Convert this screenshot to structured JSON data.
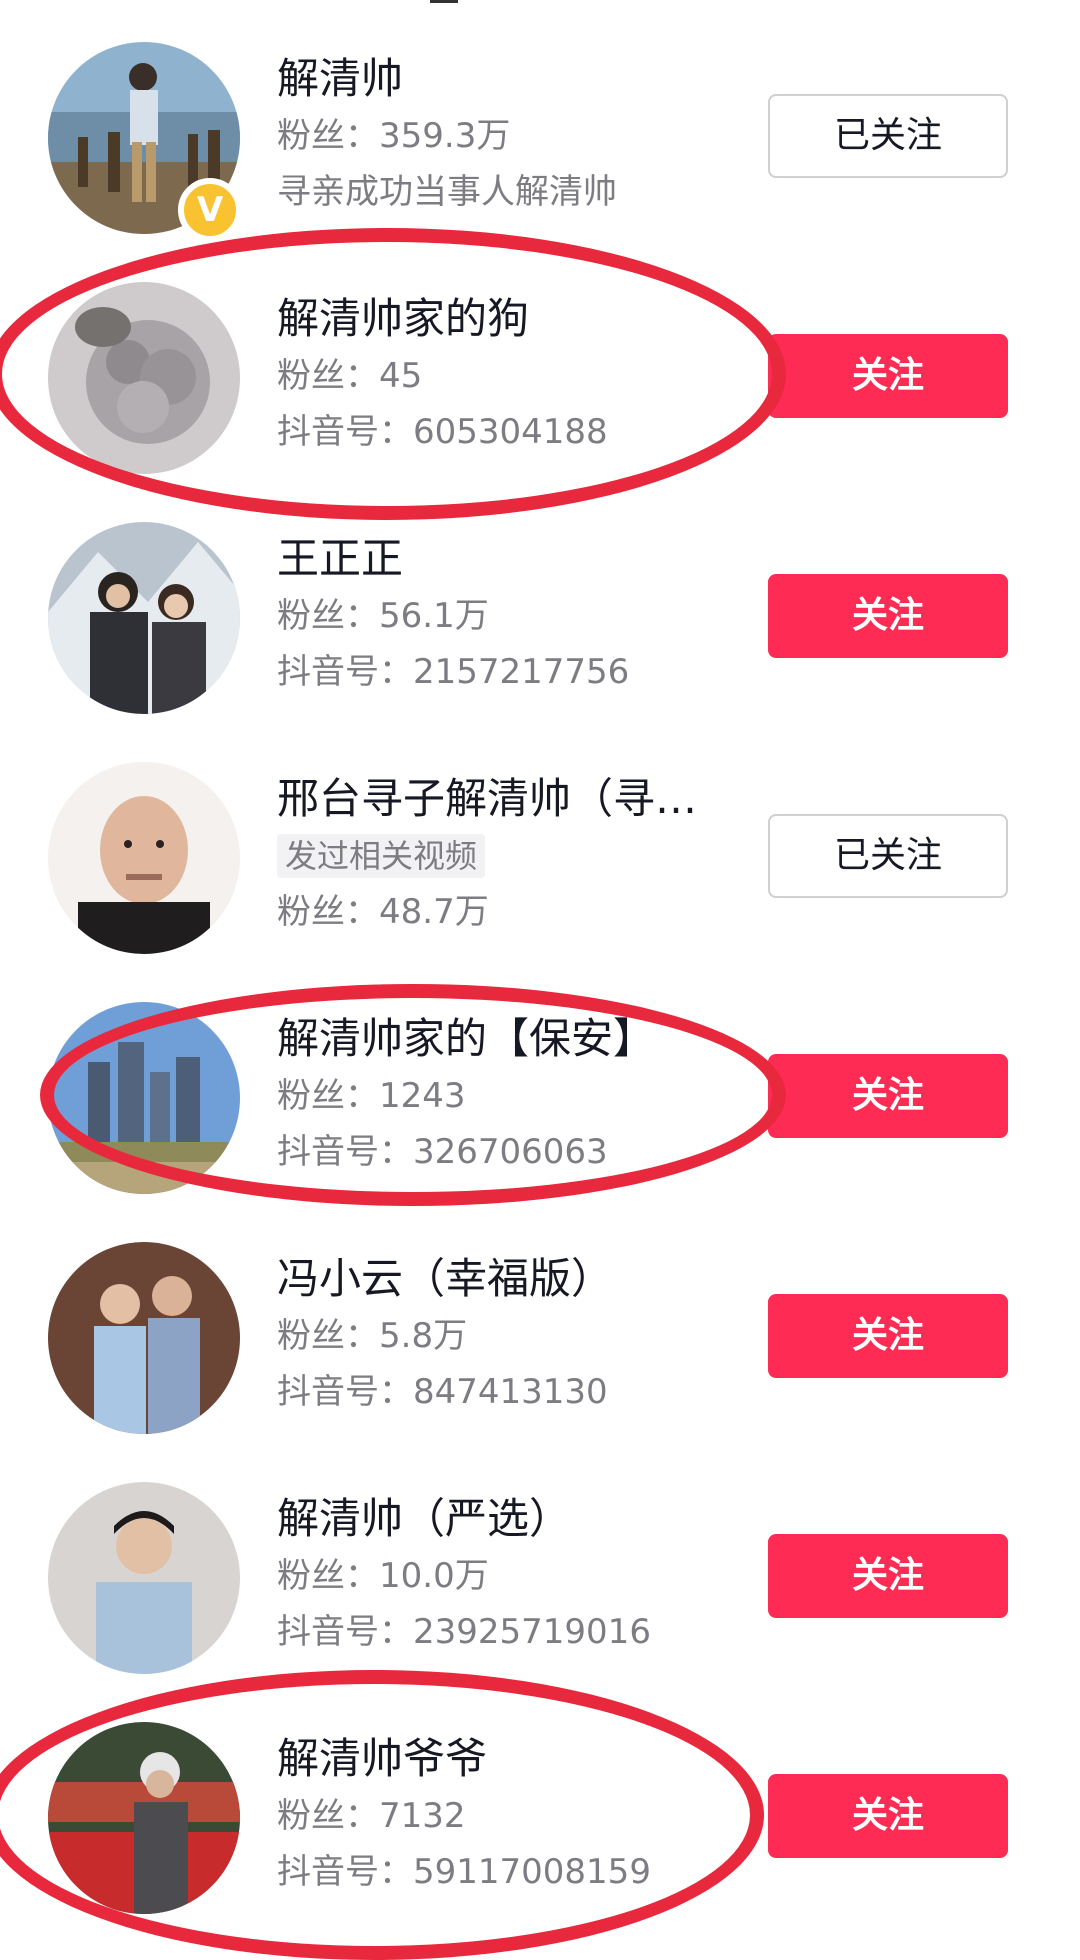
{
  "fans_prefix": "粉丝：",
  "id_prefix": "抖音号：",
  "users": [
    {
      "name": "解清帅",
      "fans": "359.3万",
      "subtitle": "寻亲成功当事人解清帅",
      "button_label": "已关注",
      "verified": true
    },
    {
      "name": "解清帅家的狗",
      "fans": "45",
      "douyin_id": "605304188",
      "button_label": "关注"
    },
    {
      "name": "王正正",
      "fans": "56.1万",
      "douyin_id": "2157217756",
      "button_label": "关注"
    },
    {
      "name": "邢台寻子解清帅（寻…",
      "tag": "发过相关视频",
      "fans": "48.7万",
      "button_label": "已关注"
    },
    {
      "name": "解清帅家的【保安】",
      "fans": "1243",
      "douyin_id": "326706063",
      "button_label": "关注"
    },
    {
      "name": "冯小云（幸福版）",
      "fans": "5.8万",
      "douyin_id": "847413130",
      "button_label": "关注"
    },
    {
      "name": "解清帅（严选）",
      "fans": "10.0万",
      "douyin_id": "23925719016",
      "button_label": "关注"
    },
    {
      "name": "解清帅爷爷",
      "fans": "7132",
      "douyin_id": "59117008159",
      "button_label": "关注"
    }
  ],
  "colors": {
    "follow_button": "#fe2c55",
    "highlight_circle": "#e8283c",
    "verified_badge": "#f8c230"
  }
}
